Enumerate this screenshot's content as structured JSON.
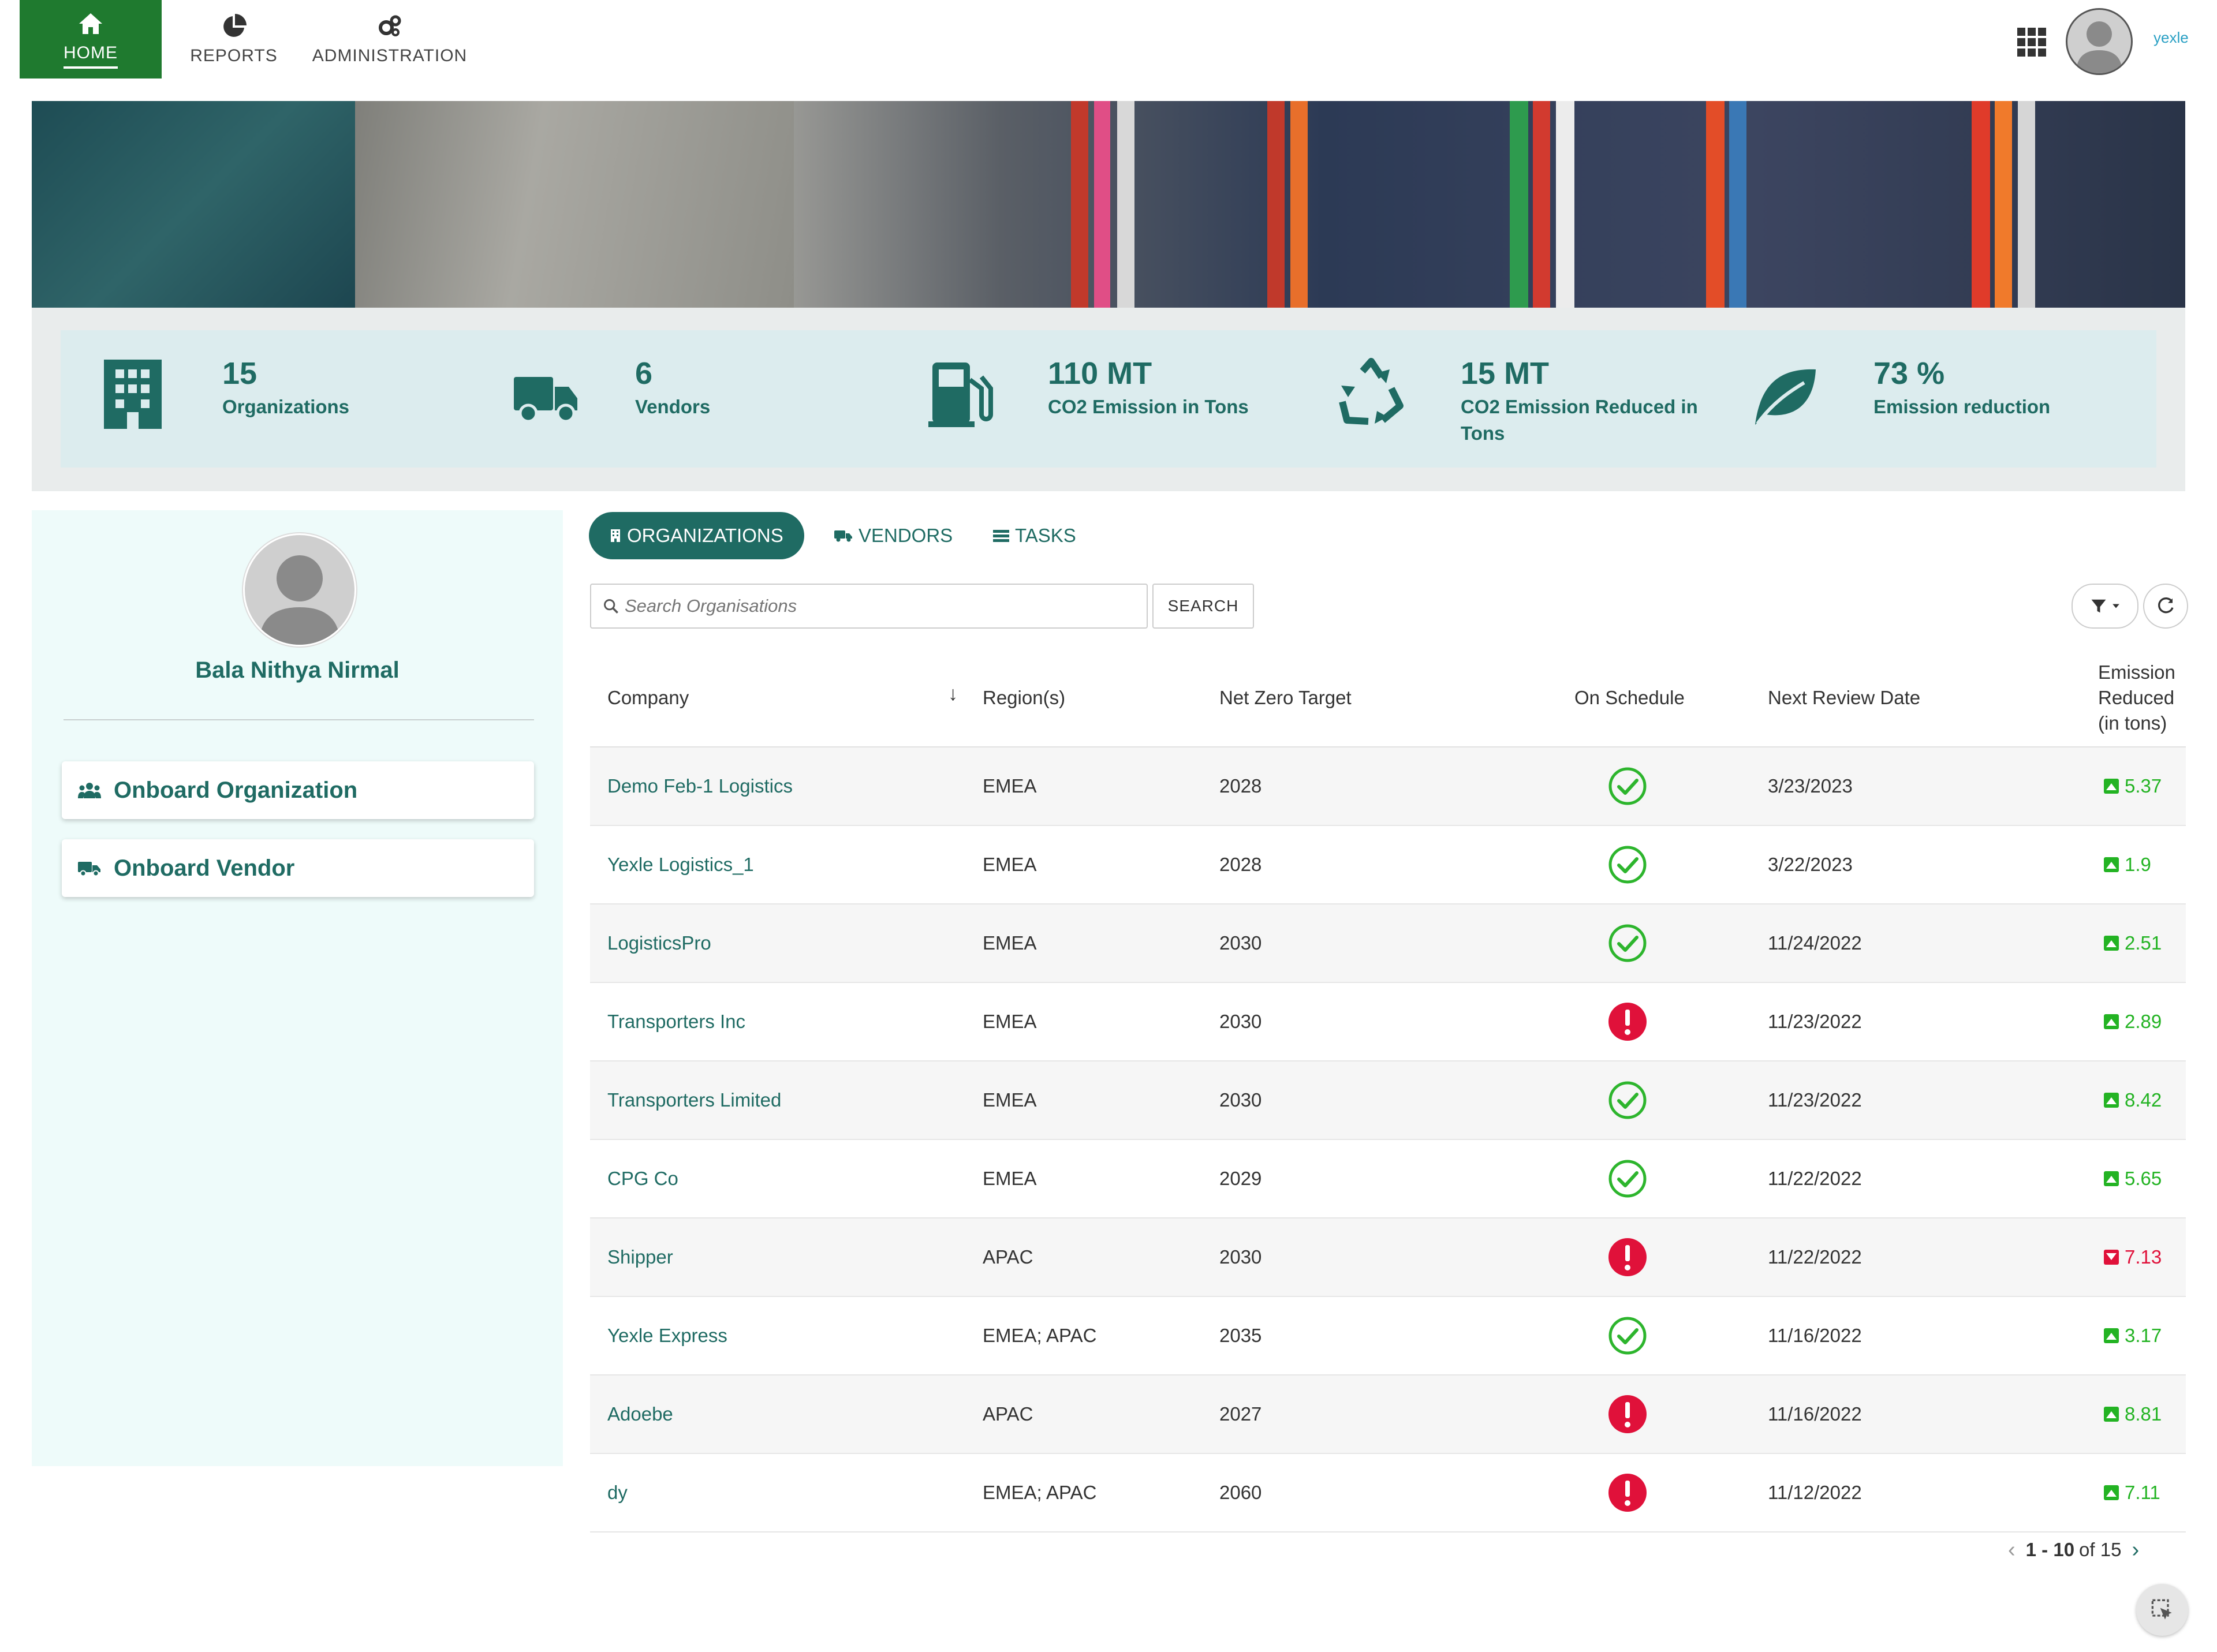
{
  "nav": {
    "home": "HOME",
    "reports": "REPORTS",
    "administration": "ADMINISTRATION",
    "brand": "yexle",
    "accent": "#1f7a2f"
  },
  "stats": [
    {
      "value": "15",
      "label": "Organizations",
      "icon": "building-icon"
    },
    {
      "value": "6",
      "label": "Vendors",
      "icon": "truck-icon"
    },
    {
      "value": "110  MT",
      "label": "CO2 Emission in Tons",
      "icon": "fuel-pump-icon"
    },
    {
      "value": "15  MT",
      "label": "CO2 Emission Reduced in Tons",
      "icon": "recycle-icon"
    },
    {
      "value": "73 %",
      "label": "Emission reduction",
      "icon": "leaf-icon"
    }
  ],
  "profile": {
    "name": "Bala Nithya Nirmal",
    "onboard_org": "Onboard Organization",
    "onboard_vendor": "Onboard Vendor"
  },
  "tabs": {
    "organizations": "ORGANIZATIONS",
    "vendors": "VENDORS",
    "tasks": "TASKS"
  },
  "search": {
    "placeholder": "Search Organisations",
    "button": "SEARCH"
  },
  "table": {
    "headers": {
      "company": "Company",
      "regions": "Region(s)",
      "net_zero": "Net Zero Target",
      "on_schedule": "On Schedule",
      "next_review": "Next Review Date",
      "emission": "Emission Reduced (in tons)"
    },
    "rows": [
      {
        "company": "Demo Feb-1 Logistics",
        "region": "EMEA",
        "target": "2028",
        "on_schedule": true,
        "review": "3/23/2023",
        "emission": "5.37",
        "trend": "up"
      },
      {
        "company": "Yexle Logistics_1",
        "region": "EMEA",
        "target": "2028",
        "on_schedule": true,
        "review": "3/22/2023",
        "emission": "1.9",
        "trend": "up"
      },
      {
        "company": "LogisticsPro",
        "region": "EMEA",
        "target": "2030",
        "on_schedule": true,
        "review": "11/24/2022",
        "emission": "2.51",
        "trend": "up"
      },
      {
        "company": "Transporters Inc",
        "region": "EMEA",
        "target": "2030",
        "on_schedule": false,
        "review": "11/23/2022",
        "emission": "2.89",
        "trend": "up"
      },
      {
        "company": "Transporters Limited",
        "region": "EMEA",
        "target": "2030",
        "on_schedule": true,
        "review": "11/23/2022",
        "emission": "8.42",
        "trend": "up"
      },
      {
        "company": "CPG Co",
        "region": "EMEA",
        "target": "2029",
        "on_schedule": true,
        "review": "11/22/2022",
        "emission": "5.65",
        "trend": "up"
      },
      {
        "company": "Shipper",
        "region": "APAC",
        "target": "2030",
        "on_schedule": false,
        "review": "11/22/2022",
        "emission": "7.13",
        "trend": "down"
      },
      {
        "company": "Yexle Express",
        "region": "EMEA; APAC",
        "target": "2035",
        "on_schedule": true,
        "review": "11/16/2022",
        "emission": "3.17",
        "trend": "up"
      },
      {
        "company": "Adoebe",
        "region": "APAC",
        "target": "2027",
        "on_schedule": false,
        "review": "11/16/2022",
        "emission": "8.81",
        "trend": "up"
      },
      {
        "company": "dy",
        "region": "EMEA; APAC",
        "target": "2060",
        "on_schedule": false,
        "review": "11/12/2022",
        "emission": "7.11",
        "trend": "up"
      }
    ]
  },
  "pager": {
    "range": "1 - 10",
    "of_text": "of 15"
  },
  "colors": {
    "primary": "#1f6b63",
    "ok_green": "#2db52d",
    "alert_red": "#e0113a",
    "up_green": "#23b323",
    "down_red": "#e0113a"
  }
}
